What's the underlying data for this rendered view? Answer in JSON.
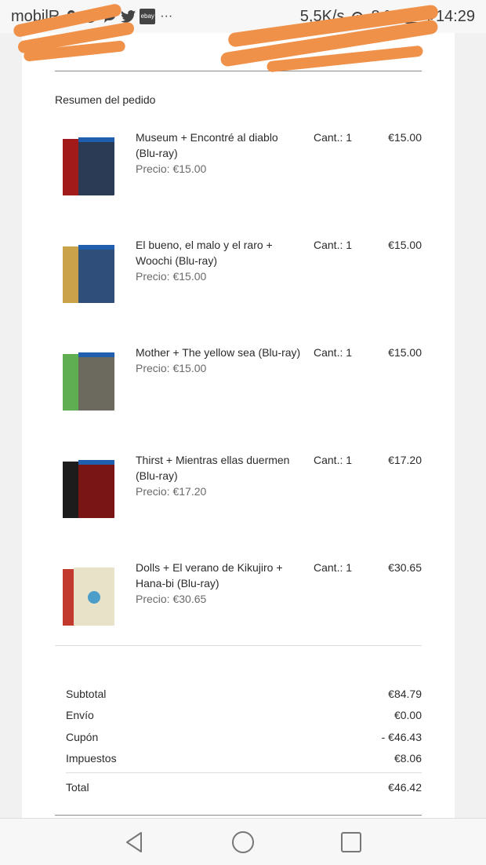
{
  "status_bar": {
    "carrier": "mobilR",
    "speed": "5,5K/s",
    "battery_text": "+",
    "battery_pct": "8 %",
    "time": "14:29",
    "icons": [
      "location-icon",
      "whatsapp-icon",
      "chat-icon",
      "twitter-icon",
      "ebay-icon",
      "more-icon",
      "alarm-icon"
    ],
    "ebay_label": "ebay",
    "more_glyph": "···"
  },
  "order": {
    "section_title": "Resumen del pedido",
    "qty_label": "Cant.: 1",
    "items": [
      {
        "name": "Museum + Encontré al diablo (Blu-ray)",
        "price_line": "Precio: €15.00",
        "qty": "Cant.: 1",
        "total": "€15.00",
        "cover_a": "#a31a1a",
        "cover_b": "#2b3a55"
      },
      {
        "name": "El bueno, el malo y el raro + Woochi (Blu-ray)",
        "price_line": "Precio: €15.00",
        "qty": "Cant.: 1",
        "total": "€15.00",
        "cover_a": "#c9a24a",
        "cover_b": "#2f4f7a"
      },
      {
        "name": "Mother + The yellow sea (Blu-ray)",
        "price_line": "Precio: €15.00",
        "qty": "Cant.: 1",
        "total": "€15.00",
        "cover_a": "#5fae52",
        "cover_b": "#6c6a5e"
      },
      {
        "name": "Thirst + Mientras ellas duermen (Blu-ray)",
        "price_line": "Precio: €17.20",
        "qty": "Cant.: 1",
        "total": "€17.20",
        "cover_a": "#1c1c1c",
        "cover_b": "#7a1515"
      },
      {
        "name": "Dolls + El verano de Kikujiro + Hana-bi (Blu-ray)",
        "price_line": "Precio: €30.65",
        "qty": "Cant.: 1",
        "total": "€30.65",
        "cover_a": "#c23a2e",
        "cover_b": "#e8e2c8"
      }
    ]
  },
  "summary": {
    "subtotal_label": "Subtotal",
    "subtotal": "€84.79",
    "shipping_label": "Envío",
    "shipping": "€0.00",
    "coupon_label": "Cupón",
    "coupon": "- €46.43",
    "taxes_label": "Impuestos",
    "taxes": "€8.06",
    "total_label": "Total",
    "total": "€46.42"
  },
  "colors": {
    "redaction": "#f0914a",
    "background": "#f1f1f1",
    "card": "#ffffff"
  }
}
